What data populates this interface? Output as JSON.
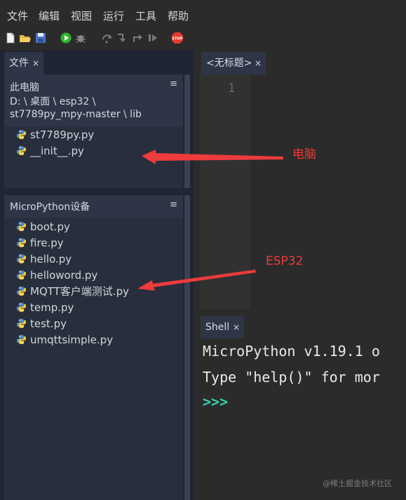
{
  "menubar": {
    "items": [
      "文件",
      "编辑",
      "视图",
      "运行",
      "工具",
      "帮助"
    ]
  },
  "toolbar": {
    "icons": [
      "new-file-icon",
      "open-file-icon",
      "save-icon",
      "run-icon",
      "debug-icon",
      "step-over-icon",
      "step-into-icon",
      "step-out-icon",
      "resume-icon",
      "stop-icon"
    ],
    "stop_label": "STOP",
    "stop_color": "#e23b2e",
    "run_color": "#2eb82e"
  },
  "files_tab": {
    "label": "文件",
    "close": "×"
  },
  "computer_panel": {
    "title": "此电脑",
    "path_line1": "D: \\ 桌面 \\ esp32 \\",
    "path_line2": "st7789py_mpy-master \\ lib",
    "menu": "≡",
    "files": [
      "st7789py.py",
      "__init__.py"
    ]
  },
  "device_panel": {
    "title": "MicroPython设备",
    "menu": "≡",
    "files": [
      "boot.py",
      "fire.py",
      "hello.py",
      "helloword.py",
      "MQTT客户端测试.py",
      "temp.py",
      "test.py",
      "umqttsimple.py"
    ]
  },
  "editor_tab": {
    "label": "<无标题>",
    "close": "×"
  },
  "editor": {
    "line_number": "1"
  },
  "shell_tab": {
    "label": "Shell",
    "close": "×"
  },
  "shell": {
    "line1": "MicroPython v1.19.1 o",
    "line2": "Type \"help()\" for mor",
    "prompt": ">>>"
  },
  "annotations": {
    "computer": "电脑",
    "device": "ESP32",
    "color": "#ee3b3b"
  },
  "watermark": "@稀土掘金技术社区"
}
